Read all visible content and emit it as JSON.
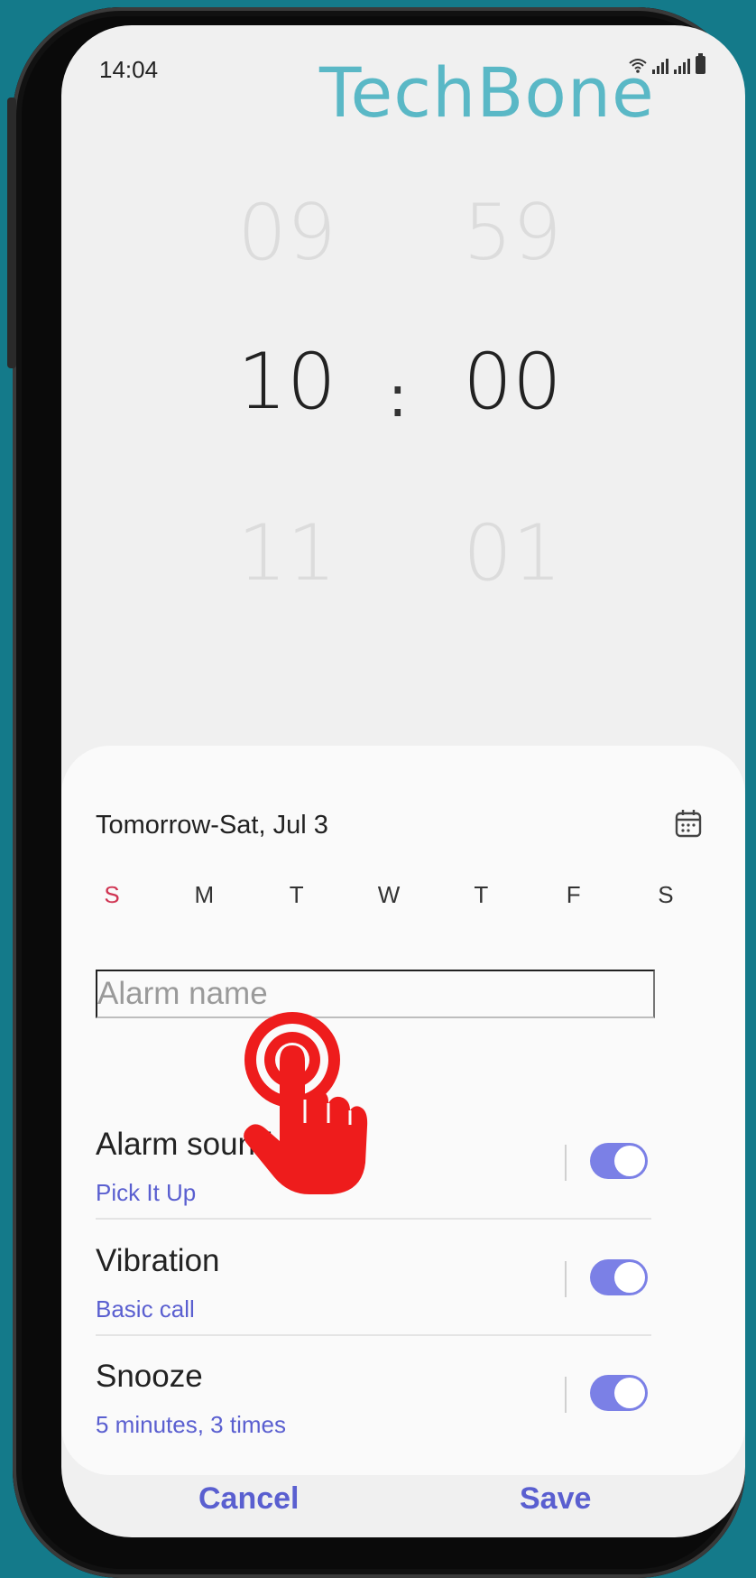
{
  "status_bar": {
    "time": "14:04"
  },
  "watermark": "TechBone",
  "time_picker": {
    "hour_prev": "09",
    "hour": "10",
    "hour_next": "11",
    "minute_prev": "59",
    "minute": "00",
    "minute_next": "01",
    "separator": ":"
  },
  "alarm": {
    "date_label": "Tomorrow-Sat, Jul 3",
    "days": [
      "S",
      "M",
      "T",
      "W",
      "T",
      "F",
      "S"
    ],
    "name_placeholder": "Alarm name",
    "settings": [
      {
        "title": "Alarm sound",
        "subtitle": "Pick It Up",
        "enabled": true
      },
      {
        "title": "Vibration",
        "subtitle": "Basic call",
        "enabled": true
      },
      {
        "title": "Snooze",
        "subtitle": "5 minutes, 3 times",
        "enabled": true
      }
    ]
  },
  "actions": {
    "cancel": "Cancel",
    "save": "Save"
  },
  "colors": {
    "accent": "#5a5fd0",
    "toggle_on": "#7b80e6",
    "sunday": "#d03452",
    "pointer_hand": "#ee1c1c",
    "background": "#147a8a"
  }
}
